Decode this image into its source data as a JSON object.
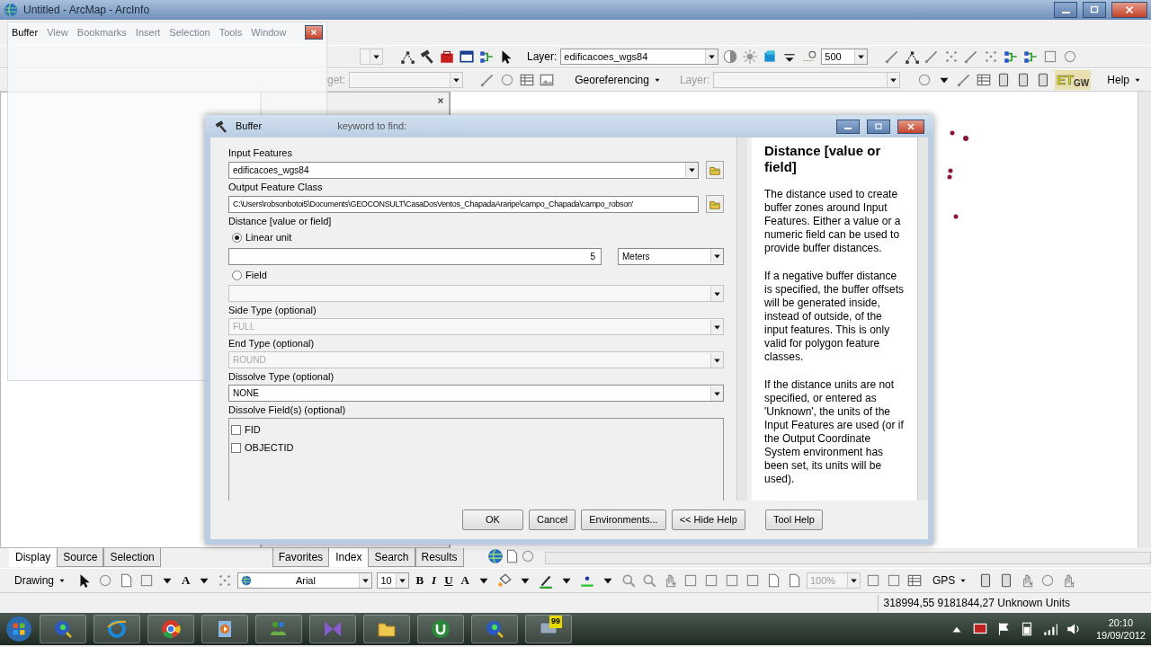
{
  "window": {
    "title": "Untitled - ArcMap - ArcInfo"
  },
  "ghost_window": {
    "title": "Buffer",
    "menu": [
      "View",
      "Bookmarks",
      "Insert",
      "Selection",
      "Tools",
      "Window"
    ]
  },
  "toolbar": {
    "layer_label": "Layer:",
    "layer": "edificacoes_wgs84",
    "scale": "500"
  },
  "georef_toolbar": {
    "target_label": "get:",
    "menu": "Georeferencing",
    "layer_label": "Layer:",
    "logo": [
      "ET",
      "GW"
    ],
    "help": "Help"
  },
  "search_window": {
    "prompt": "keyword to find:",
    "tabs": [
      {
        "label": "Favorites",
        "selected": false
      },
      {
        "label": "Index",
        "selected": true
      },
      {
        "label": "Search",
        "selected": false
      },
      {
        "label": "Results",
        "selected": false
      }
    ]
  },
  "dialog": {
    "title": "Buffer",
    "params": [
      {
        "kind": "select",
        "label": "Input Features",
        "value": "edificacoes_wgs84",
        "disabled": false,
        "browse": true
      },
      {
        "kind": "path",
        "label": "Output Feature Class",
        "value": "C:\\Users\\robsonbotoi5\\Documents\\GEOCONSULT\\CasaDosVentos_ChapadaAraripe\\campo_Chapada\\campo_robson'",
        "browse": true
      },
      {
        "kind": "distance",
        "label": "Distance [value or field]",
        "options": [
          {
            "label": "Linear unit",
            "selected": true,
            "value": "5",
            "unit": "Meters"
          },
          {
            "label": "Field",
            "selected": false
          }
        ]
      },
      {
        "kind": "select",
        "label": "Side Type (optional)",
        "value": "FULL",
        "disabled": true,
        "browse": false
      },
      {
        "kind": "select",
        "label": "End Type (optional)",
        "value": "ROUND",
        "disabled": true,
        "browse": false
      },
      {
        "kind": "select",
        "label": "Dissolve Type (optional)",
        "value": "NONE",
        "disabled": false,
        "browse": false
      },
      {
        "kind": "checklist",
        "label": "Dissolve Field(s) (optional)",
        "items": [
          {
            "label": "FID",
            "checked": false
          },
          {
            "label": "OBJECTID",
            "checked": false
          }
        ]
      }
    ],
    "help": {
      "title": "Distance [value or field]",
      "paragraphs": [
        "The distance used to create buffer zones around Input Features. Either a value or a numeric field can be used to provide buffer distances.",
        "If a negative buffer distance is specified, the buffer offsets will be generated inside, instead of outside, of the input features. This is only valid for polygon feature classes.",
        "If the distance units are not specified, or entered as 'Unknown', the units of the Input Features are used (or if the Output Coordinate System environment has been set, its units will be used)."
      ]
    },
    "buttons": [
      "OK",
      "Cancel",
      "Environments...",
      "<< Hide Help",
      "Tool Help"
    ]
  },
  "toc_tabs": [
    {
      "label": "Display",
      "selected": true
    },
    {
      "label": "Source",
      "selected": false
    },
    {
      "label": "Selection",
      "selected": false
    }
  ],
  "drawing_toolbar": {
    "menu": "Drawing",
    "text_tool": "A",
    "font": "Arial",
    "size": "10",
    "format": [
      "B",
      "I",
      "U"
    ],
    "font_color": "A",
    "zoom": "100%",
    "gps": "GPS"
  },
  "status_bar": {
    "coordinates": "318994,55  9181844,27 Unknown Units"
  },
  "taskbar": {
    "badge": "99",
    "time": "20:10",
    "date": "19/09/2012"
  }
}
